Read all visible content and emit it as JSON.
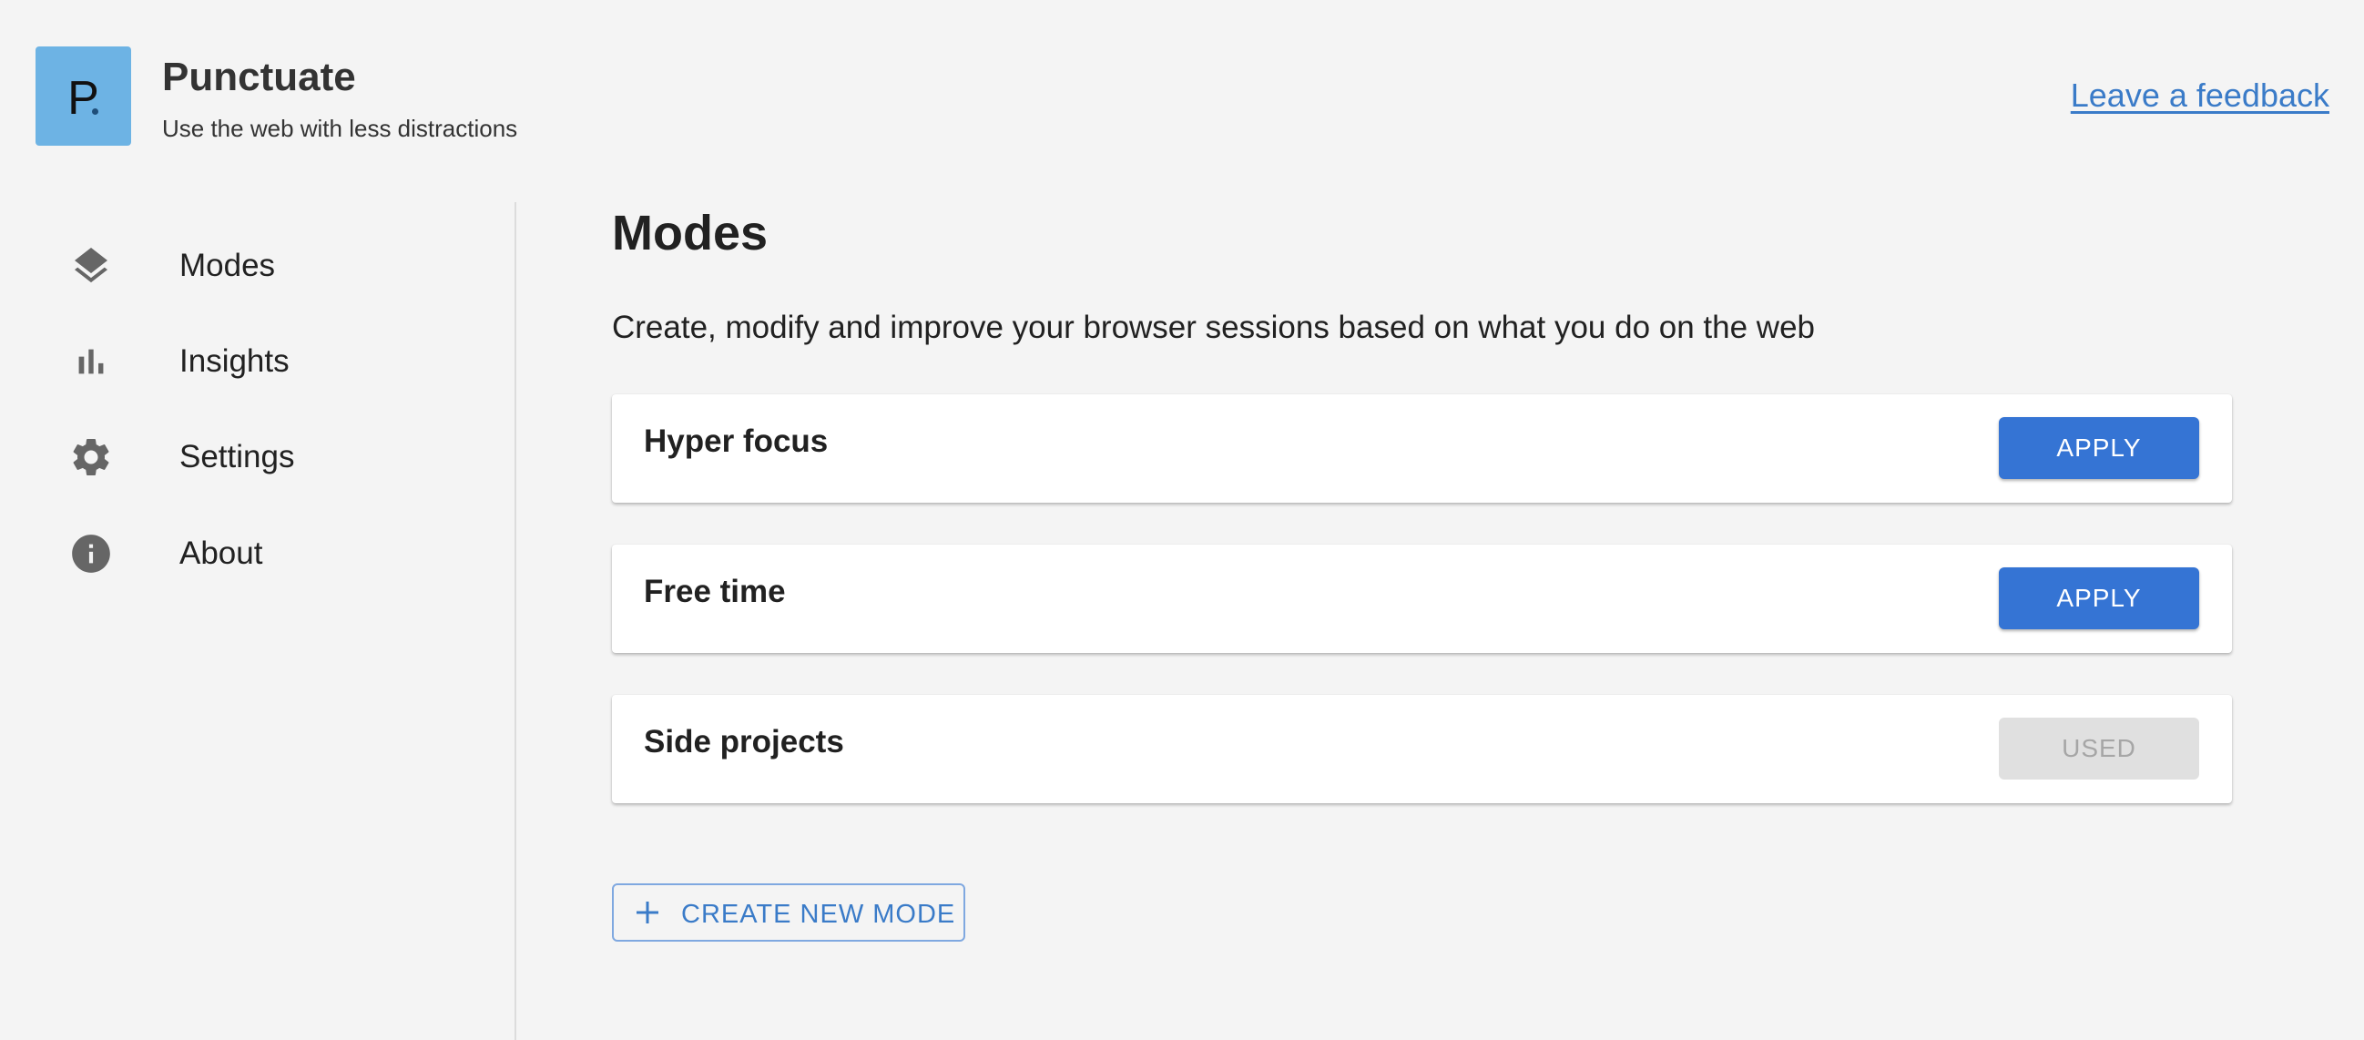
{
  "app": {
    "logo_letter": "P",
    "title": "Punctuate",
    "subtitle": "Use the web with less distractions",
    "feedback_link": "Leave a feedback",
    "brand_color": "#6db3e4",
    "accent_color": "#3574d4"
  },
  "sidebar": {
    "items": [
      {
        "label": "Modes",
        "icon": "layers-icon"
      },
      {
        "label": "Insights",
        "icon": "bar-chart-icon"
      },
      {
        "label": "Settings",
        "icon": "gear-icon"
      },
      {
        "label": "About",
        "icon": "info-icon"
      }
    ]
  },
  "main": {
    "title": "Modes",
    "description": "Create, modify and improve your browser sessions based on what you do on the web",
    "modes": [
      {
        "name": "Hyper focus",
        "button": "APPLY",
        "state": "apply"
      },
      {
        "name": "Free time",
        "button": "APPLY",
        "state": "apply"
      },
      {
        "name": "Side projects",
        "button": "USED",
        "state": "used"
      }
    ],
    "create_button": "CREATE NEW MODE"
  }
}
